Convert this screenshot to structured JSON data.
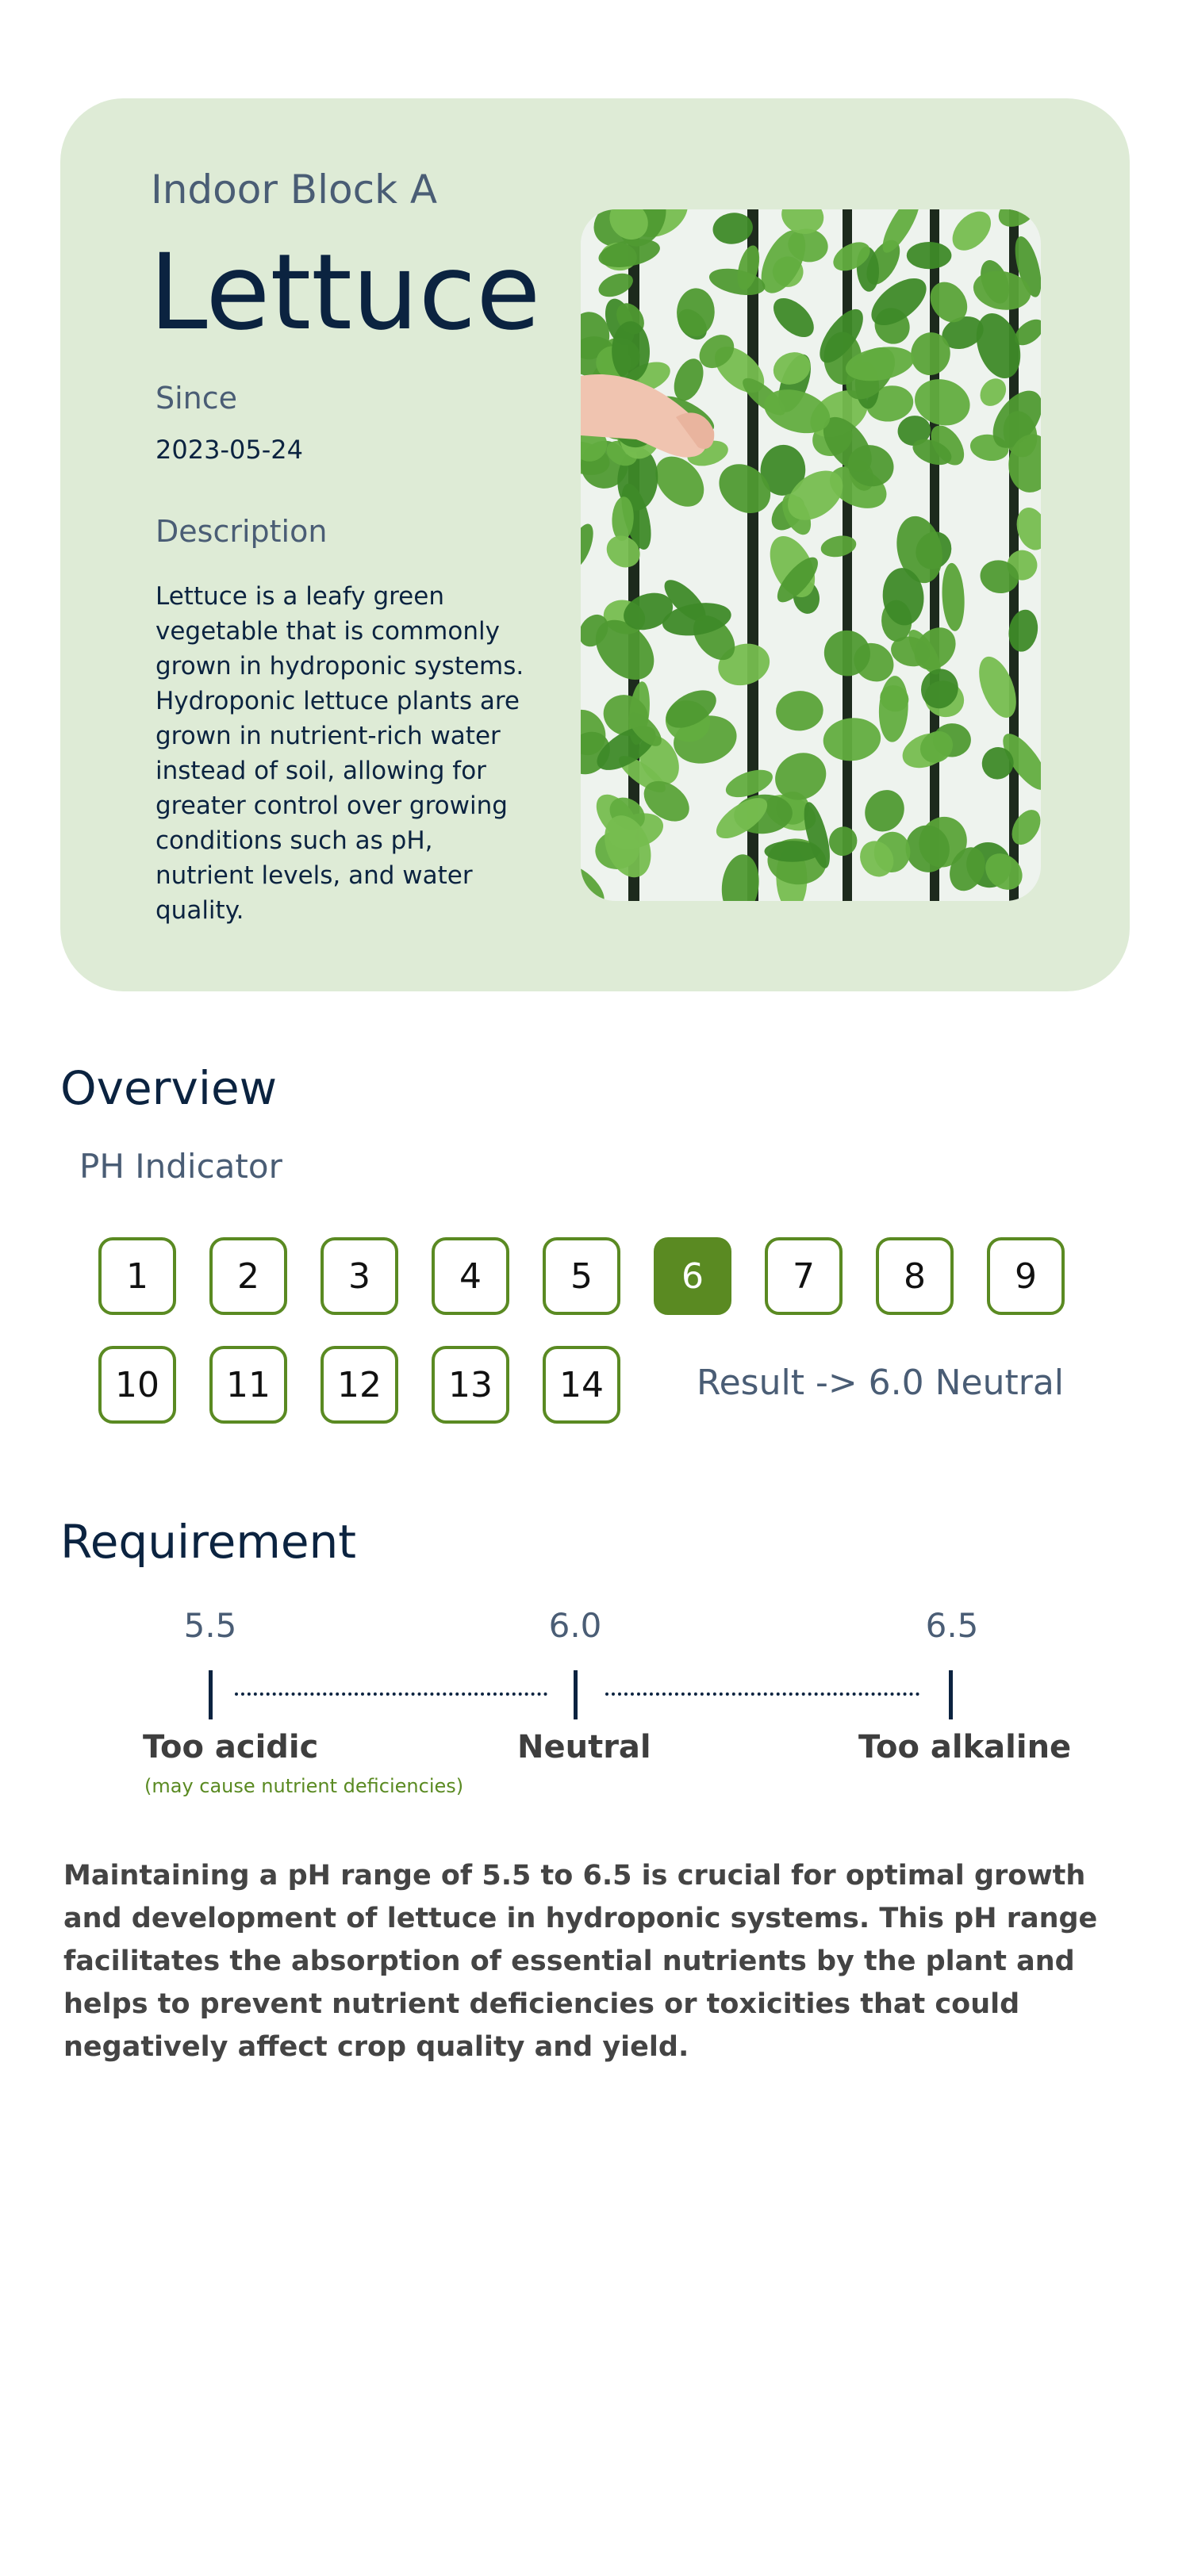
{
  "crop": {
    "block": "Indoor Block A",
    "name": "Lettuce",
    "since_label": "Since",
    "since_value": "2023-05-24",
    "description_label": "Description",
    "description": "Lettuce is a leafy green vegetable that is commonly grown in hydroponic systems. Hydroponic lettuce plants are grown in nutrient-rich water instead of soil, allowing for greater control over growing conditions such as pH, nutrient levels, and water quality.",
    "photo_icon": "hydroponic-lettuce-photo"
  },
  "overview": {
    "title": "Overview",
    "indicator_label": "PH Indicator",
    "scale": [
      "1",
      "2",
      "3",
      "4",
      "5",
      "6",
      "7",
      "8",
      "9",
      "10",
      "11",
      "12",
      "13",
      "14"
    ],
    "selected": "6",
    "result": "Result -> 6.0 Neutral",
    "accent_color": "#5a8a22"
  },
  "requirement": {
    "title": "Requirement",
    "ticks": [
      {
        "value": "5.5",
        "name": "Too acidic",
        "note": "(may cause nutrient deficiencies)"
      },
      {
        "value": "6.0",
        "name": "Neutral",
        "note": ""
      },
      {
        "value": "6.5",
        "name": "Too alkaline",
        "note": ""
      }
    ],
    "text": "Maintaining a pH range of 5.5 to 6.5 is crucial for optimal growth and development of lettuce in hydroponic systems. This pH range facilitates the absorption of essential nutrients by the plant and helps to prevent nutrient deficiencies or toxicities that could negatively affect crop quality and yield."
  }
}
